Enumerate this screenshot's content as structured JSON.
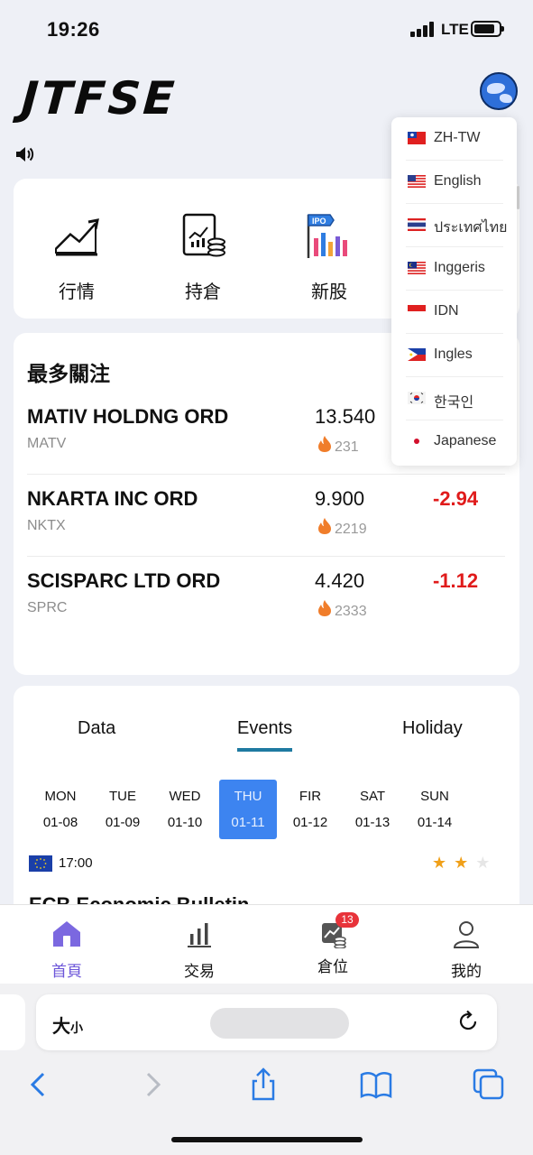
{
  "status_bar": {
    "time": "19:26",
    "network": "LTE"
  },
  "header": {
    "logo": "JTFSE",
    "globe_icon": "globe-icon",
    "sound_icon": "speaker-icon"
  },
  "quick_menu": [
    {
      "label": "行情",
      "icon": "chart-trend-icon"
    },
    {
      "label": "持倉",
      "icon": "holdings-receipt-icon"
    },
    {
      "label": "新股",
      "icon": "ipo-icon"
    }
  ],
  "watchlist": {
    "title": "最多關注",
    "rows": [
      {
        "name": "MATIV HOLDNG ORD",
        "code": "MATV",
        "price": "13.540",
        "heat": "231",
        "change": ""
      },
      {
        "name": "NKARTA INC ORD",
        "code": "NKTX",
        "price": "9.900",
        "heat": "2219",
        "change": "-2.94"
      },
      {
        "name": "SCISPARC LTD ORD",
        "code": "SPRC",
        "price": "4.420",
        "heat": "2333",
        "change": "-1.12"
      }
    ]
  },
  "calendar": {
    "tabs": [
      {
        "label": "Data",
        "active": false
      },
      {
        "label": "Events",
        "active": true
      },
      {
        "label": "Holiday",
        "active": false
      }
    ],
    "days": [
      {
        "dow": "MON",
        "date": "01-08",
        "selected": false
      },
      {
        "dow": "TUE",
        "date": "01-09",
        "selected": false
      },
      {
        "dow": "WED",
        "date": "01-10",
        "selected": false
      },
      {
        "dow": "THU",
        "date": "01-11",
        "selected": true
      },
      {
        "dow": "FIR",
        "date": "01-12",
        "selected": false
      },
      {
        "dow": "SAT",
        "date": "01-13",
        "selected": false
      },
      {
        "dow": "SUN",
        "date": "01-14",
        "selected": false
      }
    ],
    "event": {
      "time": "17:00",
      "rating": 2,
      "max_rating": 3,
      "title": "ECB Economic Bulletin"
    }
  },
  "tabbar": [
    {
      "label": "首頁",
      "icon": "home-icon",
      "active": true
    },
    {
      "label": "交易",
      "icon": "bar-chart-icon",
      "active": false
    },
    {
      "label": "倉位",
      "icon": "position-icon",
      "active": false,
      "badge": "13"
    },
    {
      "label": "我的",
      "icon": "user-icon",
      "active": false
    }
  ],
  "language_menu": [
    {
      "label": "ZH-TW",
      "flag": "flag-tw-icon"
    },
    {
      "label": "English",
      "flag": "flag-us-icon"
    },
    {
      "label": "ประเทศไทย",
      "flag": "flag-th-icon"
    },
    {
      "label": "Inggeris",
      "flag": "flag-my-icon"
    },
    {
      "label": "IDN",
      "flag": "flag-id-icon"
    },
    {
      "label": "Ingles",
      "flag": "flag-ph-icon"
    },
    {
      "label": "한국인",
      "flag": "flag-kr-icon"
    },
    {
      "label": "Japanese",
      "flag": "flag-jp-icon"
    }
  ],
  "browser": {
    "text_size_label": "大",
    "text_size_small": "小"
  },
  "colors": {
    "accent": "#3d84f0",
    "negative": "#e01b1b",
    "tab_active": "#6c56d9",
    "underline": "#1f7aa1"
  }
}
